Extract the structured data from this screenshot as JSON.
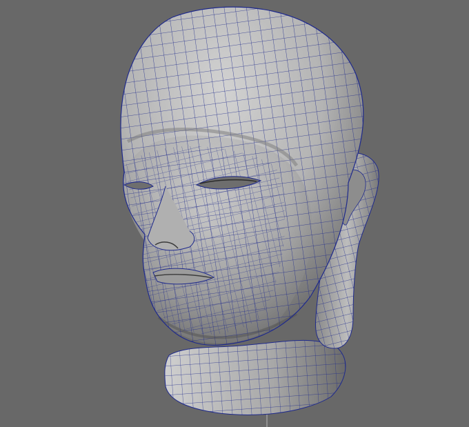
{
  "viewport": {
    "background": "#686868",
    "mesh_color": "#1f2a8c",
    "surface_light": "#c6c6c6",
    "surface_mid": "#a5a5a5",
    "surface_dark": "#5a5a5a",
    "axis_line_color": "#b8b8b8"
  },
  "model": {
    "subject": "head-sculpt",
    "display_mode": "wireframe-on-shaded"
  }
}
